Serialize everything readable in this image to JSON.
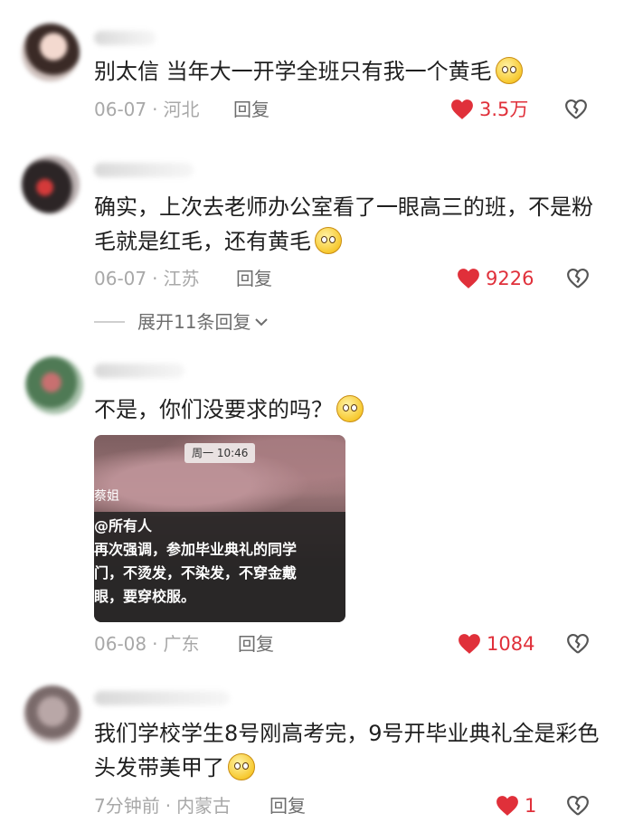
{
  "comments": [
    {
      "text": "别太信 当年大一开学全班只有我一个黄毛",
      "emoji": "pleading-face-emoji",
      "date": "06-07",
      "location": "河北",
      "reply": "回复",
      "likes": "3.5万"
    },
    {
      "text": "确实，上次去老师办公室看了一眼高三的班，不是粉毛就是红毛，还有黄毛",
      "emoji": "drooling-face-emoji",
      "date": "06-07",
      "location": "江苏",
      "reply": "回复",
      "likes": "9226",
      "expand": "展开11条回复"
    },
    {
      "text": "不是，你们没要求的吗？",
      "emoji": "flushed-face-emoji",
      "date": "06-08",
      "location": "广东",
      "reply": "回复",
      "likes": "1084",
      "screenshot": {
        "time": "周一 10:46",
        "sender": "蔡姐",
        "lines": [
          "@所有人",
          "再次强调，参加毕业典礼的同学",
          "门，不烫发，不染发，不穿金戴",
          "眼，要穿校服。"
        ]
      }
    },
    {
      "text": "我们学校学生8号刚高考完，9号开毕业典礼全是彩色头发带美甲了",
      "emoji": "joy-face-emoji",
      "date": "7分钟前",
      "location": "内蒙古",
      "reply": "回复",
      "likes": "1"
    }
  ],
  "colors": {
    "like_red": "#e0303a",
    "meta_gray": "#a8a8a8"
  }
}
